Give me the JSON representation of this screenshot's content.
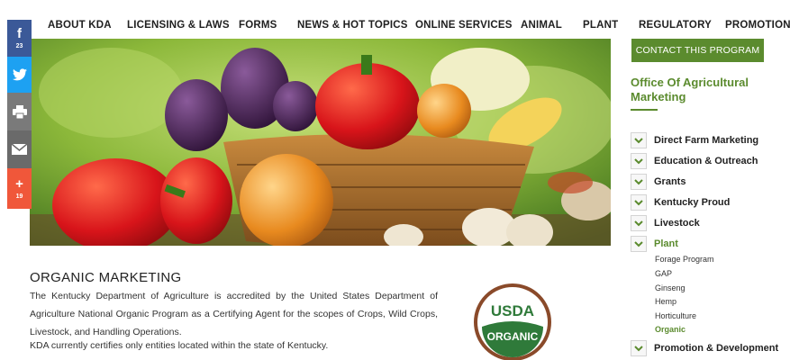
{
  "nav": {
    "items": [
      "ABOUT KDA",
      "LICENSING & LAWS",
      "FORMS",
      "NEWS & HOT TOPICS",
      "ONLINE SERVICES",
      "ANIMAL",
      "PLANT",
      "REGULATORY",
      "PROMOTIONAL"
    ]
  },
  "share": {
    "facebook_count": "23",
    "addthis_count": "19",
    "icons": [
      "facebook-icon",
      "twitter-icon",
      "print-icon",
      "email-icon",
      "plus-icon"
    ]
  },
  "hero": {
    "alt": "Basket of vegetables"
  },
  "article": {
    "title": "ORGANIC MARKETING",
    "paragraph1": "The Kentucky Department of Agriculture is accredited by the United States Department of Agriculture National Organic Program as a Certifying Agent for the scopes of Crops, Wild Crops, Livestock, and Handling Operations.",
    "paragraph2": "KDA currently certifies only entities located within the state of Kentucky."
  },
  "seal": {
    "top_text": "USDA",
    "bottom_text": "ORGANIC"
  },
  "sidebar": {
    "contact_label": "CONTACT THIS PROGRAM",
    "office_title": "Office Of Agricultural Marketing",
    "items": [
      "Direct Farm Marketing",
      "Education & Outreach",
      "Grants",
      "Kentucky Proud",
      "Livestock",
      "Plant",
      "Promotion & Development"
    ],
    "active_item": "Plant",
    "plant_sub": [
      "Forage Program",
      "GAP",
      "Ginseng",
      "Hemp",
      "Horticulture",
      "Organic"
    ],
    "active_sub": "Organic"
  },
  "colors": {
    "accent_green": "#5b8b2e",
    "facebook": "#3b5998",
    "twitter": "#1da1f2",
    "addthis": "#f0573a"
  }
}
